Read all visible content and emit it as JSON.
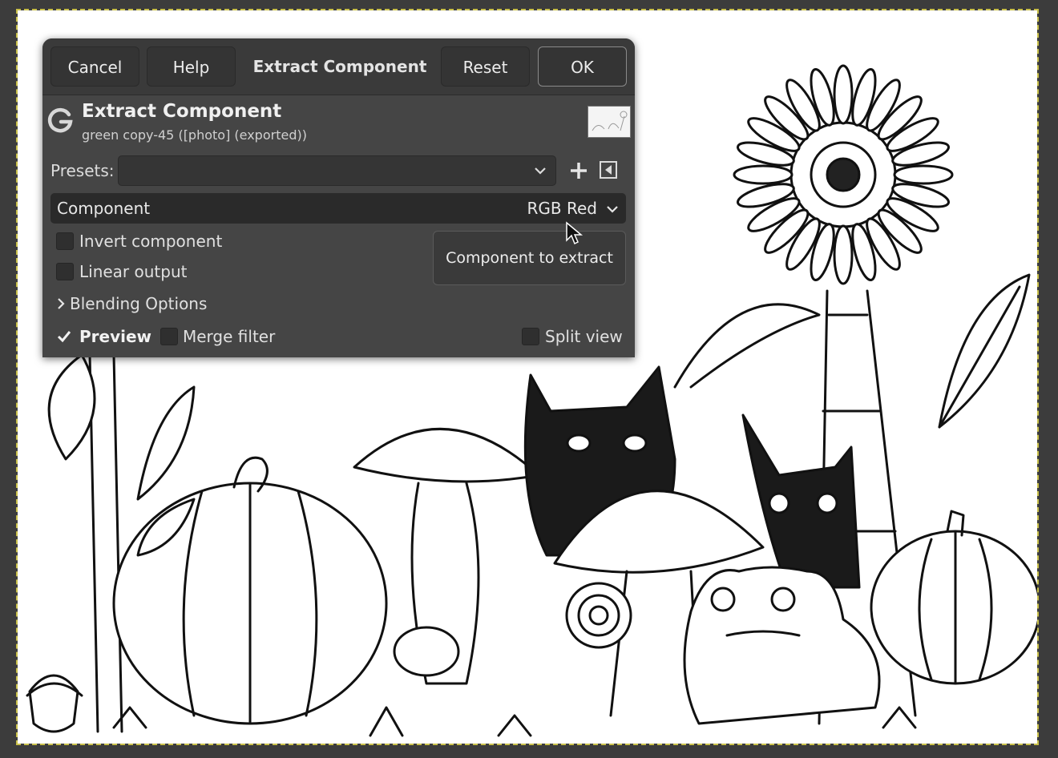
{
  "header": {
    "cancel_label": "Cancel",
    "help_label": "Help",
    "title": "Extract Component",
    "reset_label": "Reset",
    "ok_label": "OK"
  },
  "filter": {
    "name": "Extract Component",
    "layer": "green copy-45 ([photo] (exported))",
    "logo_icon": "gimp-logo-icon"
  },
  "presets": {
    "label": "Presets:",
    "value": ""
  },
  "component": {
    "label": "Component",
    "value": "RGB Red"
  },
  "options": {
    "invert_label": "Invert component",
    "invert_checked": false,
    "linear_label": "Linear output",
    "linear_checked": false,
    "blending_label": "Blending Options"
  },
  "footer": {
    "preview_label": "Preview",
    "preview_checked": true,
    "merge_label": "Merge filter",
    "merge_checked": false,
    "split_label": "Split view",
    "split_checked": false
  },
  "tooltip": {
    "text": "Component to extract"
  },
  "colors": {
    "dialog_bg": "#454545",
    "header_bg": "#3a3a3a",
    "canvas_bg": "#ffffff",
    "selection_marching_ants": "#c9c04a"
  }
}
